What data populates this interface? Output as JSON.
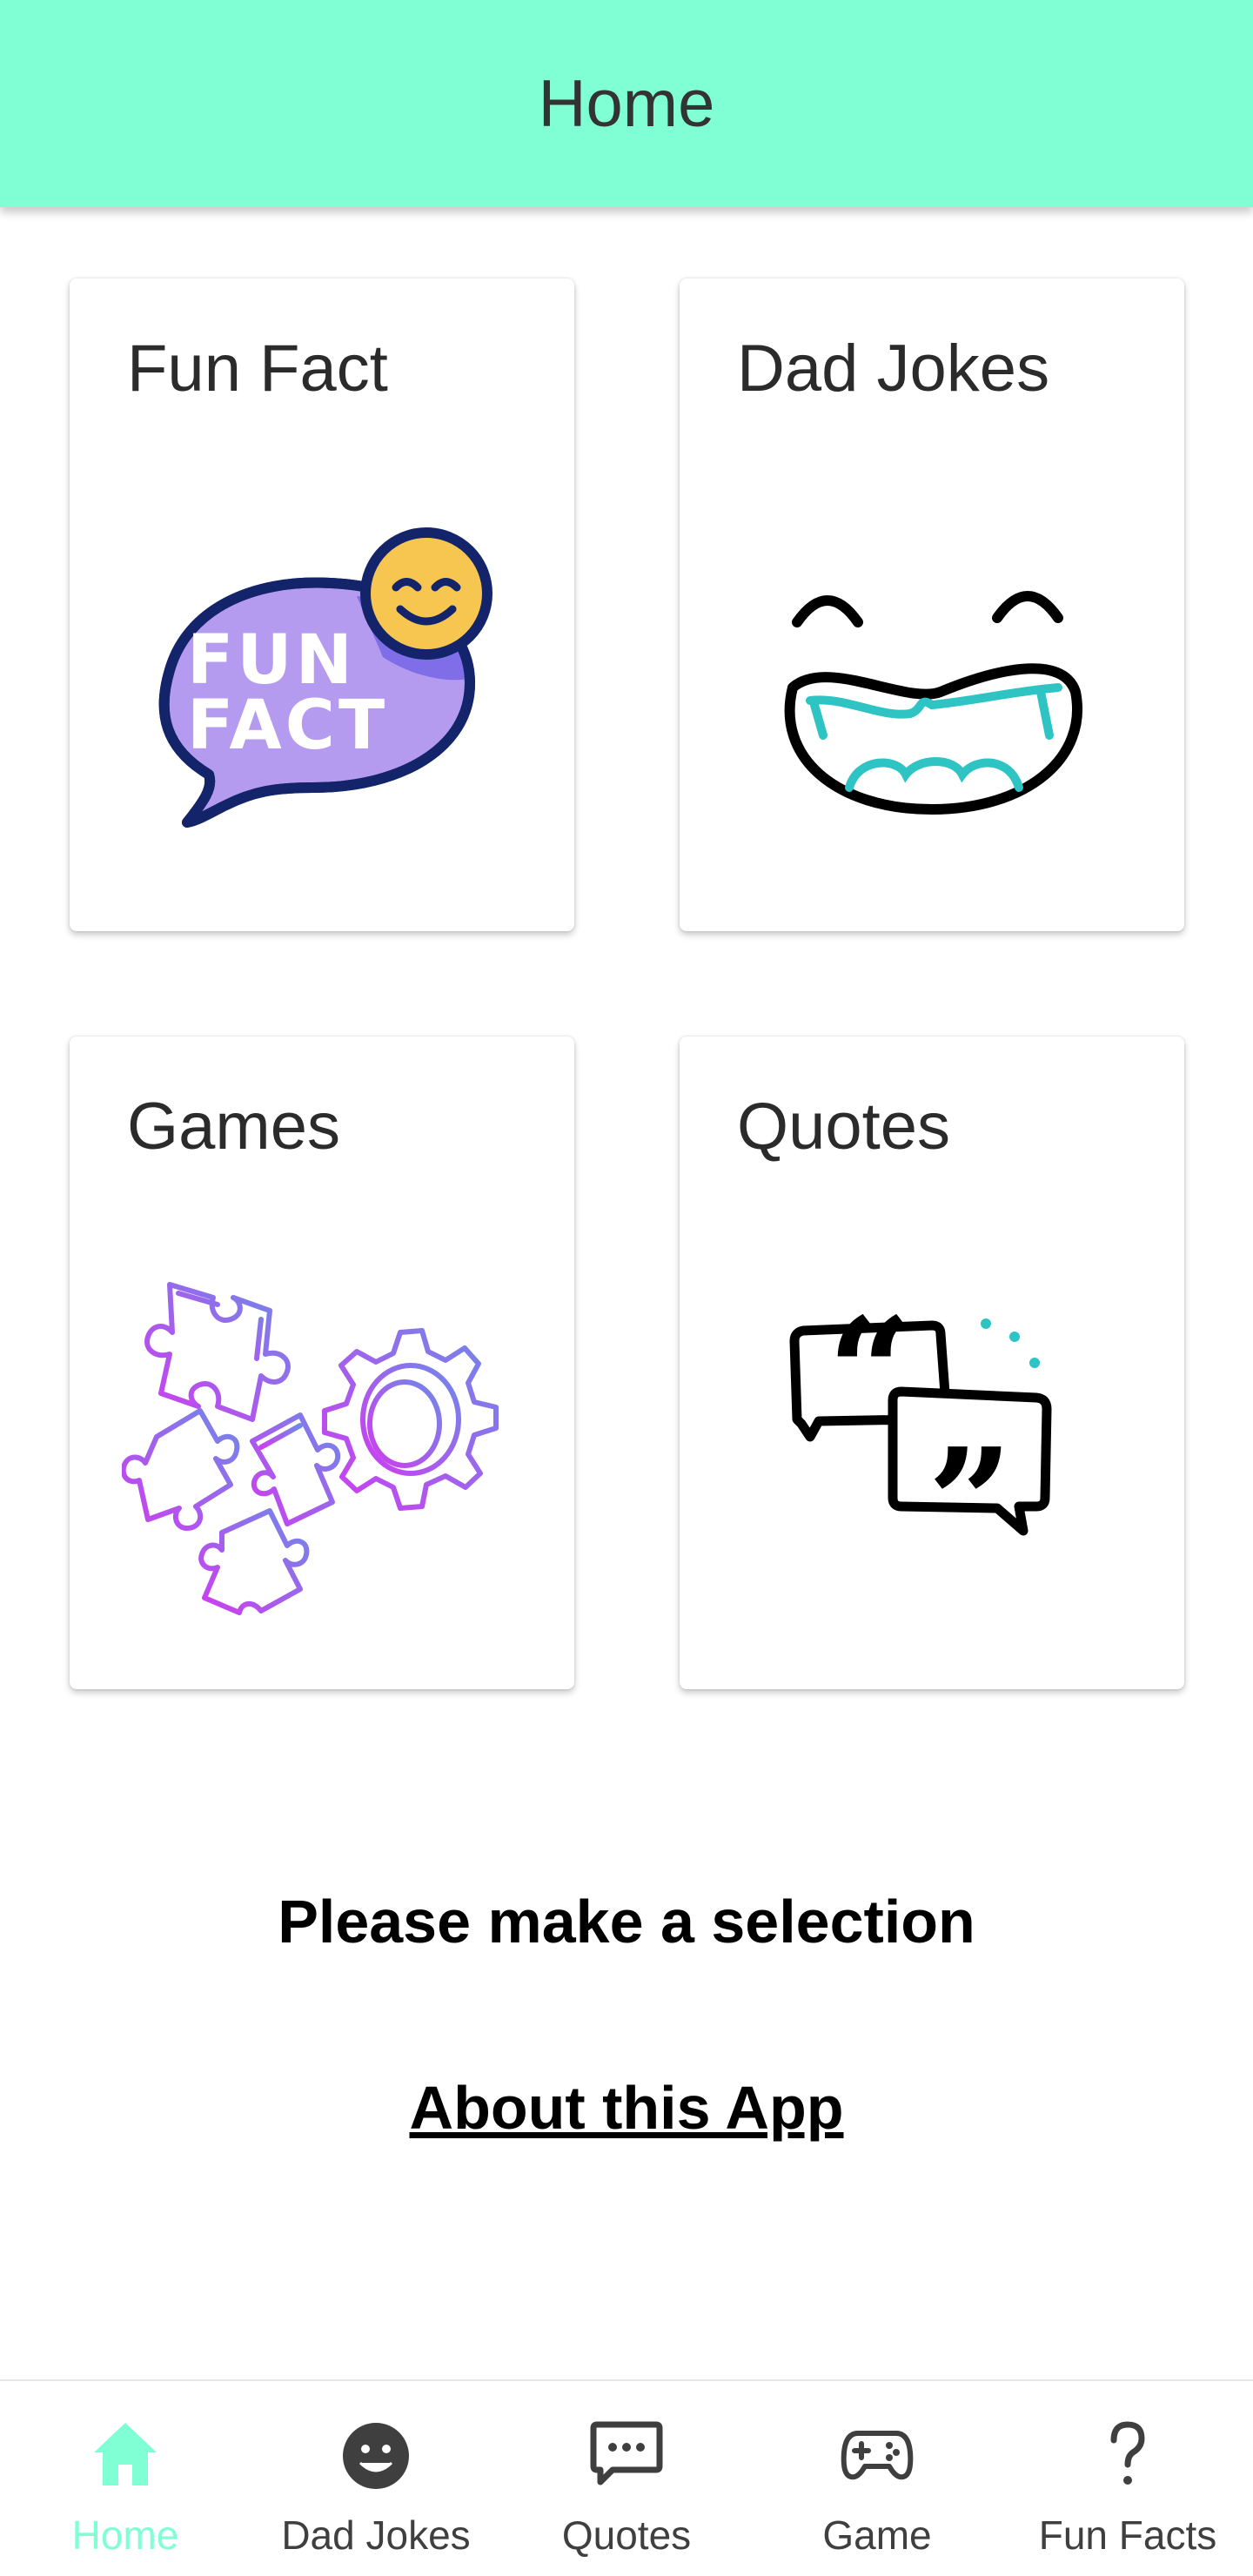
{
  "app_bar": {
    "title": "Home"
  },
  "cards": [
    {
      "id": "fun-fact",
      "title": "Fun Fact",
      "icon": "fun-fact-bubble-icon",
      "badge_text": [
        "FUN",
        "FACT"
      ]
    },
    {
      "id": "dad-jokes",
      "title": "Dad Jokes",
      "icon": "laughing-face-icon"
    },
    {
      "id": "games",
      "title": "Games",
      "icon": "puzzle-gear-icon"
    },
    {
      "id": "quotes",
      "title": "Quotes",
      "icon": "quote-bubbles-icon"
    }
  ],
  "prompt": "Please make a selection",
  "about_link": "About this App",
  "bottom_nav": {
    "active": "Home",
    "items": [
      {
        "label": "Home",
        "icon": "home-icon"
      },
      {
        "label": "Dad Jokes",
        "icon": "smiley-face-icon"
      },
      {
        "label": "Quotes",
        "icon": "chat-bubble-icon"
      },
      {
        "label": "Game",
        "icon": "gamepad-icon"
      },
      {
        "label": "Fun Facts",
        "icon": "question-mark-icon"
      }
    ]
  },
  "colors": {
    "accent": "#80ffd4",
    "text_dark": "#333333",
    "nav_inactive": "#3f3f3f"
  }
}
